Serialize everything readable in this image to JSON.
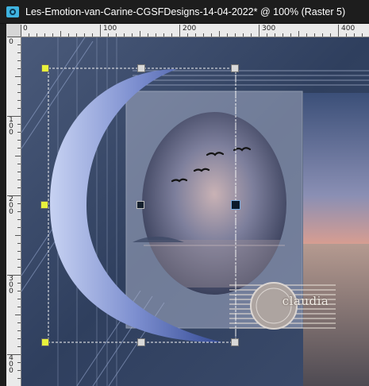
{
  "window": {
    "title": "Les-Emotion-van-Carine-CGSFDesigns-14-04-2022* @ 100% (Raster 5)"
  },
  "ruler": {
    "top_labels": [
      "0",
      "100",
      "200",
      "300",
      "400"
    ],
    "left_labels": [
      "0",
      "100",
      "200",
      "300",
      "400"
    ]
  },
  "watermark": {
    "text": "claudia",
    "small_text": "CLAUDIA"
  },
  "colors": {
    "title_bg": "#1d1d1d",
    "ruler_bg": "#eaeaea",
    "handle_yellow": "#e8f23c"
  }
}
